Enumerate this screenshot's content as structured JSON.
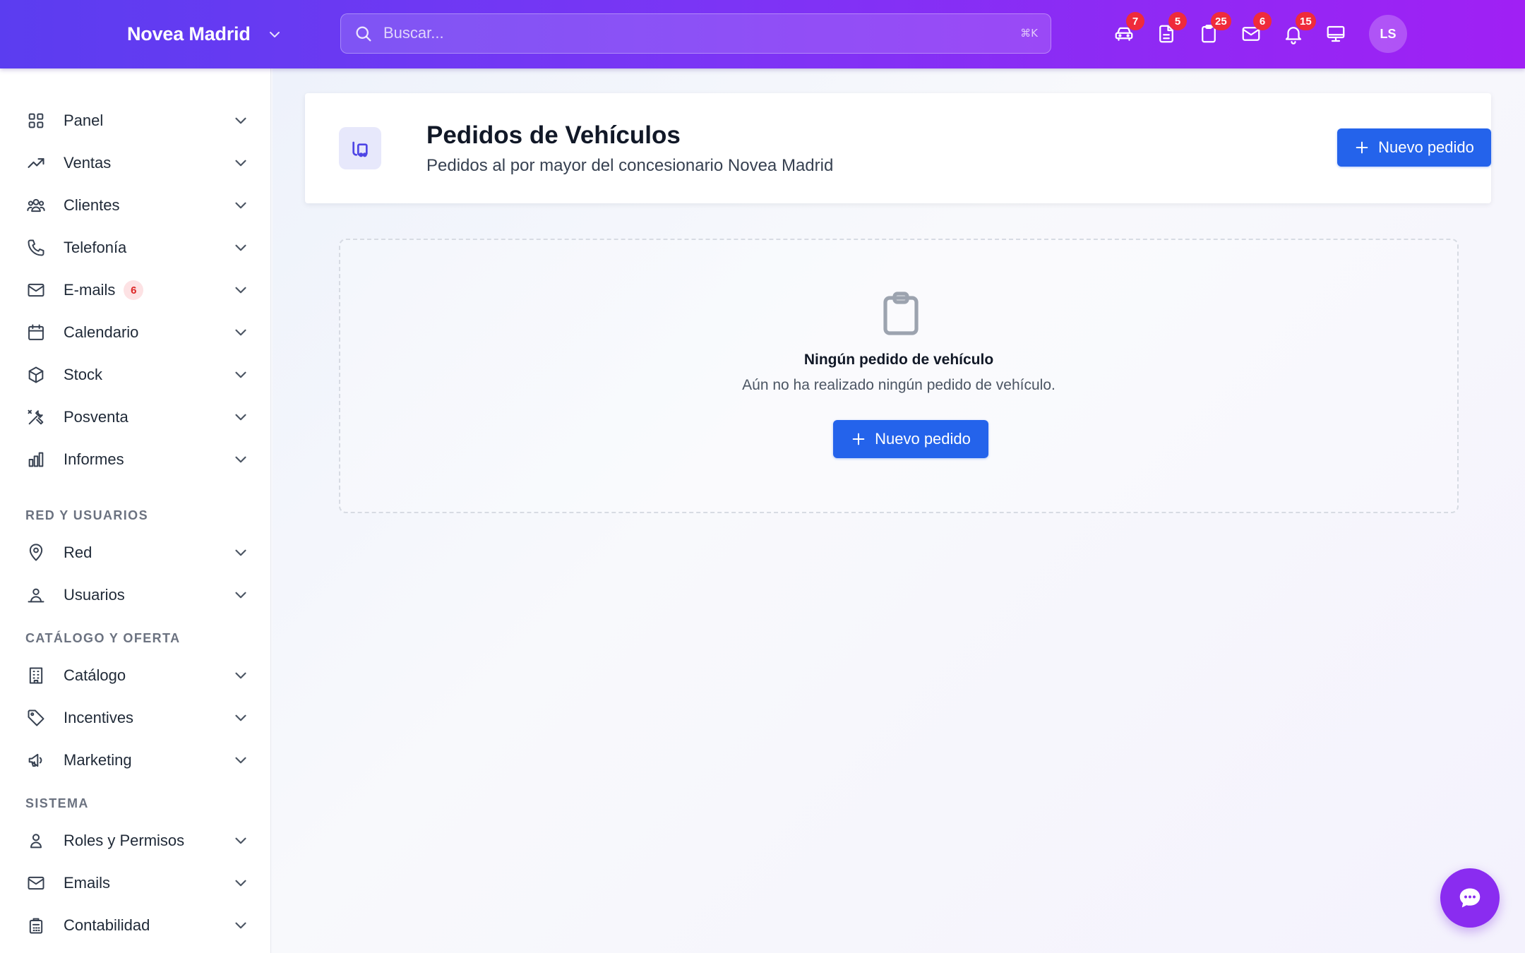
{
  "topbar": {
    "dealer_name": "Novea Madrid",
    "search_placeholder": "Buscar...",
    "search_shortcut": "⌘K",
    "icons": [
      {
        "name": "car-icon",
        "badge": "7"
      },
      {
        "name": "document-icon",
        "badge": "5"
      },
      {
        "name": "clipboard-icon",
        "badge": "25"
      },
      {
        "name": "mail-icon",
        "badge": "6"
      },
      {
        "name": "bell-icon",
        "badge": "15"
      },
      {
        "name": "monitor-icon",
        "badge": ""
      }
    ],
    "avatar_initials": "LS",
    "colors": {
      "gradient_start": "#5b3df0",
      "gradient_end": "#a020f4",
      "badge": "#ef2b3b"
    }
  },
  "sidebar": {
    "items": [
      {
        "label": "Panel",
        "icon": "grid-icon"
      },
      {
        "label": "Ventas",
        "icon": "trending-up-icon"
      },
      {
        "label": "Clientes",
        "icon": "users-icon"
      },
      {
        "label": "Telefonía",
        "icon": "phone-icon"
      },
      {
        "label": "E-mails",
        "icon": "mail-icon",
        "badge": "6"
      },
      {
        "label": "Calendario",
        "icon": "calendar-icon"
      },
      {
        "label": "Stock",
        "icon": "box-icon"
      },
      {
        "label": "Posventa",
        "icon": "tools-icon"
      },
      {
        "label": "Informes",
        "icon": "bar-chart-icon"
      }
    ],
    "sections": [
      {
        "label": "RED Y USUARIOS",
        "items": [
          {
            "label": "Red",
            "icon": "map-pin-icon"
          },
          {
            "label": "Usuarios",
            "icon": "user-group-icon"
          }
        ]
      },
      {
        "label": "CATÁLOGO Y OFERTA",
        "items": [
          {
            "label": "Catálogo",
            "icon": "building-icon"
          },
          {
            "label": "Incentives",
            "icon": "tag-icon"
          },
          {
            "label": "Marketing",
            "icon": "megaphone-icon"
          }
        ]
      },
      {
        "label": "SISTEMA",
        "items": [
          {
            "label": "Roles y Permisos",
            "icon": "user-icon"
          },
          {
            "label": "Emails",
            "icon": "mail-icon"
          },
          {
            "label": "Contabilidad",
            "icon": "calculator-icon"
          }
        ]
      }
    ]
  },
  "main": {
    "title": "Pedidos de Vehículos",
    "subtitle": "Pedidos al por mayor del concesionario Novea Madrid",
    "new_order_label": "Nuevo pedido",
    "empty": {
      "title": "Ningún pedido de vehículo",
      "text": "Aún no ha realizado ningún pedido de vehículo.",
      "button_label": "Nuevo pedido"
    },
    "accent_color": "#2463eb"
  }
}
